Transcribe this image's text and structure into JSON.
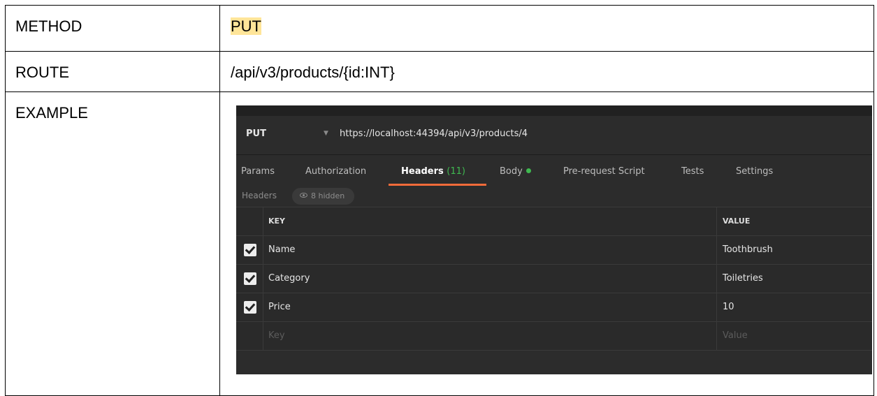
{
  "doc": {
    "method_label": "METHOD",
    "method_value": "PUT",
    "route_label": "ROUTE",
    "route_value": "/api/v3/products/{id:INT}",
    "example_label": "EXAMPLE"
  },
  "postman": {
    "method": "PUT",
    "url": "https://localhost:44394/api/v3/products/4",
    "tabs": {
      "params": "Params",
      "authorization": "Authorization",
      "headers": "Headers",
      "headers_count": "(11)",
      "body": "Body",
      "prerequest": "Pre-request Script",
      "tests": "Tests",
      "settings": "Settings"
    },
    "subheader": {
      "label": "Headers",
      "hidden": "8 hidden"
    },
    "columns": {
      "key": "KEY",
      "value": "VALUE"
    },
    "rows": [
      {
        "key": "Name",
        "value": "Toothbrush",
        "checked": true
      },
      {
        "key": "Category",
        "value": "Toiletries",
        "checked": true
      },
      {
        "key": "Price",
        "value": "10",
        "checked": true
      }
    ],
    "placeholders": {
      "key": "Key",
      "value": "Value"
    },
    "colors": {
      "accent": "#f26b3a",
      "status_green": "#3fb950",
      "highlight": "#ffe599"
    }
  }
}
